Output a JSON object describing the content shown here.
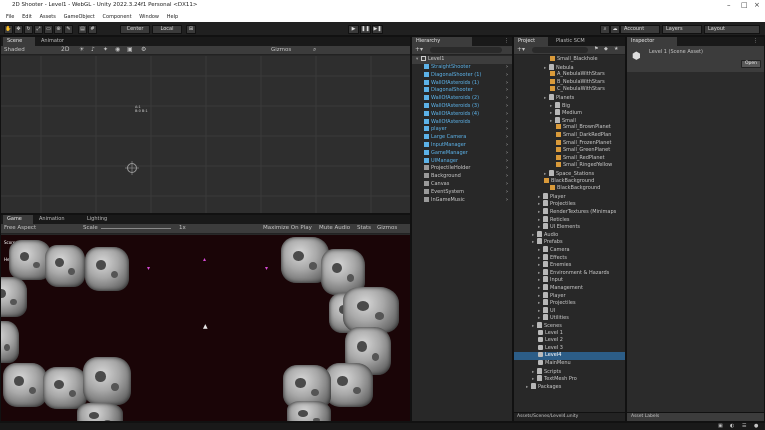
{
  "window": {
    "title": "2D Shooter - Level1 - WebGL - Unity 2022.3.24f1 Personal <DX11>"
  },
  "menu": [
    "File",
    "Edit",
    "Assets",
    "GameObject",
    "Component",
    "Window",
    "Help"
  ],
  "toolbar": {
    "center_label": "Center",
    "local_label": "Local",
    "account_label": "Account",
    "layers_label": "Layers",
    "layout_label": "Layout"
  },
  "scene": {
    "tabs": [
      "Scene",
      "Animator"
    ],
    "shading": "Shaded",
    "gizmos": "Gizmos",
    "label_text": "A:1\nB:0 B:1"
  },
  "game": {
    "tabs": [
      "Game",
      "Animation",
      "Lighting"
    ],
    "aspect": "Free Aspect",
    "scale_label": "Scale",
    "scale_value": "1x",
    "options": [
      "Maximize On Play",
      "Mute Audio",
      "Stats",
      "Gizmos"
    ],
    "overlay_lines": [
      "Score",
      "Health"
    ]
  },
  "hierarchy": {
    "tab": "Hierarchy",
    "root": "Level1",
    "items": [
      {
        "label": "StraightShooter",
        "prefab": true
      },
      {
        "label": "DiagonalShooter (1)",
        "prefab": true
      },
      {
        "label": "WallOfAsteroids (1)",
        "prefab": true
      },
      {
        "label": "DiagonalShooter",
        "prefab": true
      },
      {
        "label": "WallOfAsteroids (2)",
        "prefab": true
      },
      {
        "label": "WallOfAsteroids (3)",
        "prefab": true
      },
      {
        "label": "WallOfAsteroids (4)",
        "prefab": true
      },
      {
        "label": "WallOfAsteroids",
        "prefab": true
      },
      {
        "label": "player",
        "prefab": true
      },
      {
        "label": "Large Camera",
        "prefab": true
      },
      {
        "label": "InputManager",
        "prefab": true
      },
      {
        "label": "GameManager",
        "prefab": true
      },
      {
        "label": "UIManager",
        "prefab": true
      },
      {
        "label": "ProjectileHolder",
        "prefab": false
      },
      {
        "label": "Background",
        "prefab": false
      },
      {
        "label": "Canvas",
        "prefab": false
      },
      {
        "label": "EventSystem",
        "prefab": false
      },
      {
        "label": "InGameMusic",
        "prefab": false
      }
    ]
  },
  "project": {
    "tabs": [
      "Project",
      "Plastic SCM"
    ],
    "items": [
      {
        "label": "Small_Blackhole",
        "indent": 3,
        "kind": "asset"
      },
      {
        "label": "Nebula",
        "indent": 2,
        "kind": "folder"
      },
      {
        "label": "A_NebulaWithStars",
        "indent": 3,
        "kind": "asset"
      },
      {
        "label": "B_NebulaWithStars",
        "indent": 3,
        "kind": "asset"
      },
      {
        "label": "C_NebulaWithStars",
        "indent": 3,
        "kind": "asset"
      },
      {
        "label": "Planets",
        "indent": 2,
        "kind": "folder"
      },
      {
        "label": "Big",
        "indent": 3,
        "kind": "folder"
      },
      {
        "label": "Medium",
        "indent": 3,
        "kind": "folder"
      },
      {
        "label": "Small",
        "indent": 3,
        "kind": "folder"
      },
      {
        "label": "Small_BrownPlanet",
        "indent": 4,
        "kind": "asset"
      },
      {
        "label": "Small_DarkRedPlan",
        "indent": 4,
        "kind": "asset"
      },
      {
        "label": "Small_FrozenPlanet",
        "indent": 4,
        "kind": "asset"
      },
      {
        "label": "Small_GreenPlanet",
        "indent": 4,
        "kind": "asset"
      },
      {
        "label": "Small_RedPlanet",
        "indent": 4,
        "kind": "asset"
      },
      {
        "label": "Small_RingedYellow",
        "indent": 4,
        "kind": "asset"
      },
      {
        "label": "Space_Stations",
        "indent": 2,
        "kind": "folder"
      },
      {
        "label": "BlackBackground",
        "indent": 2,
        "kind": "asset"
      },
      {
        "label": "BlackBackground",
        "indent": 3,
        "kind": "asset"
      },
      {
        "label": "Player",
        "indent": 1,
        "kind": "folder"
      },
      {
        "label": "Projectiles",
        "indent": 1,
        "kind": "folder"
      },
      {
        "label": "RenderTextures (Minimaps",
        "indent": 1,
        "kind": "folder"
      },
      {
        "label": "Reticles",
        "indent": 1,
        "kind": "folder"
      },
      {
        "label": "UI Elements",
        "indent": 1,
        "kind": "folder"
      },
      {
        "label": "Audio",
        "indent": 0,
        "kind": "folder"
      },
      {
        "label": "Prefabs",
        "indent": 0,
        "kind": "folder"
      },
      {
        "label": "Camera",
        "indent": 1,
        "kind": "folder"
      },
      {
        "label": "Effects",
        "indent": 1,
        "kind": "folder"
      },
      {
        "label": "Enemies",
        "indent": 1,
        "kind": "folder"
      },
      {
        "label": "Environment & Hazards",
        "indent": 1,
        "kind": "folder"
      },
      {
        "label": "Input",
        "indent": 1,
        "kind": "folder"
      },
      {
        "label": "Management",
        "indent": 1,
        "kind": "folder"
      },
      {
        "label": "Player",
        "indent": 1,
        "kind": "folder"
      },
      {
        "label": "Projectiles",
        "indent": 1,
        "kind": "folder"
      },
      {
        "label": "UI",
        "indent": 1,
        "kind": "folder"
      },
      {
        "label": "Utilities",
        "indent": 1,
        "kind": "folder"
      },
      {
        "label": "Scenes",
        "indent": 0,
        "kind": "folder"
      },
      {
        "label": "Level 1",
        "indent": 1,
        "kind": "scene"
      },
      {
        "label": "Level 2",
        "indent": 1,
        "kind": "scene"
      },
      {
        "label": "Level 3",
        "indent": 1,
        "kind": "scene"
      },
      {
        "label": "Level4",
        "indent": 1,
        "kind": "scene",
        "selected": true
      },
      {
        "label": "MainMenu",
        "indent": 1,
        "kind": "scene"
      },
      {
        "label": "Scripts",
        "indent": 0,
        "kind": "folder"
      },
      {
        "label": "TextMesh Pro",
        "indent": 0,
        "kind": "folder"
      },
      {
        "label": "Packages",
        "indent": -1,
        "kind": "folder"
      }
    ],
    "footer_path": "Assets/Scenes/Level4.unity"
  },
  "inspector": {
    "tab": "Inspector",
    "title": "Level 1 (Scene Asset)",
    "open_button": "Open",
    "footer": "Asset Labels"
  },
  "colors": {
    "accent": "#2c5d87",
    "prefab_blue": "#5cb2e8",
    "background": "#191919"
  }
}
